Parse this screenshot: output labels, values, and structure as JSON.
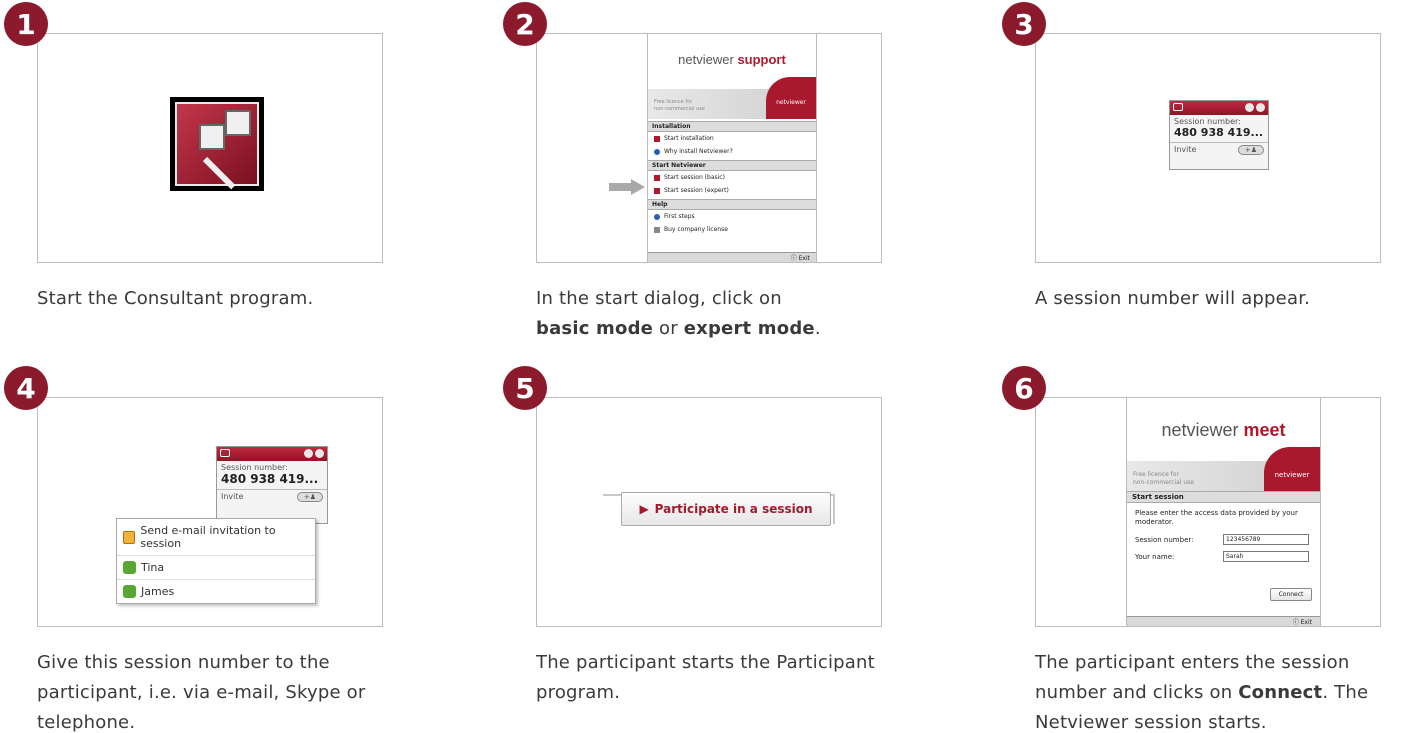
{
  "steps": [
    {
      "number": "1",
      "caption": "Start the Consultant program."
    },
    {
      "number": "2",
      "caption_pre": "In the start dialog, click on",
      "caption_b1": "basic mode",
      "caption_mid": " or ",
      "caption_b2": "expert mode",
      "caption_post": "."
    },
    {
      "number": "3",
      "caption": "A session number will appear."
    },
    {
      "number": "4",
      "caption": "Give this session number to the participant, i.e. via e-mail, Skype or telephone."
    },
    {
      "number": "5",
      "caption": "The participant starts the Participant program."
    },
    {
      "number": "6",
      "caption_pre": "The participant enters the session number and clicks on ",
      "caption_b": "Connect",
      "caption_post": ". The Netviewer session starts."
    }
  ],
  "support_dialog": {
    "logo_plain": "netviewer",
    "logo_bold": "support",
    "free_line1": "Free licence for",
    "free_line2": "non-commercial use",
    "brand": "netviewer",
    "section_installation": "Installation",
    "item_start_installation": "Start installation",
    "item_why_install": "Why install Netviewer?",
    "section_start": "Start Netviewer",
    "item_session_basic": "Start session (basic)",
    "item_session_expert": "Start session (expert)",
    "section_help": "Help",
    "item_first_steps": "First steps",
    "item_buy_license": "Buy company license",
    "exit": "ⓘ Exit"
  },
  "session_widget": {
    "label": "Session number:",
    "number": "480 938 419...",
    "invite": "Invite",
    "invite_button": "+♟"
  },
  "invite_menu": {
    "email_item": "Send e-mail invitation to session",
    "contact_1": "Tina",
    "contact_2": "James"
  },
  "participate_button": "Participate in a session",
  "meet_dialog": {
    "logo_plain": "netviewer",
    "logo_bold": "meet",
    "free_line1": "Free licence for",
    "free_line2": "non-commercial use",
    "brand": "netviewer",
    "section": "Start session",
    "instructions": "Please enter the access data provided by your moderator.",
    "session_label": "Session number:",
    "session_value": "123456789",
    "name_label": "Your name:",
    "name_value": "Sarah",
    "connect": "Connect",
    "exit": "ⓘ Exit"
  }
}
